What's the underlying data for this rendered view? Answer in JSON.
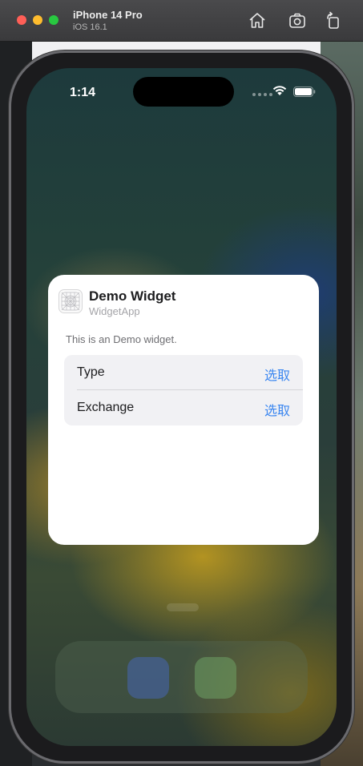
{
  "window": {
    "device_name": "iPhone 14 Pro",
    "os_version": "iOS 16.1",
    "toolbar_icons": [
      "home-icon",
      "screenshot-icon",
      "rotate-icon"
    ]
  },
  "status_bar": {
    "time": "1:14",
    "icons": [
      "wifi-icon",
      "battery-icon"
    ]
  },
  "widget_config": {
    "title": "Demo Widget",
    "app_name": "WidgetApp",
    "description": "This is an Demo widget.",
    "parameters": [
      {
        "label": "Type",
        "value": "选取"
      },
      {
        "label": "Exchange",
        "value": "选取"
      }
    ]
  },
  "colors": {
    "accent": "#3a86f0",
    "card_bg": "#ffffff",
    "params_bg": "#f1f1f4"
  }
}
